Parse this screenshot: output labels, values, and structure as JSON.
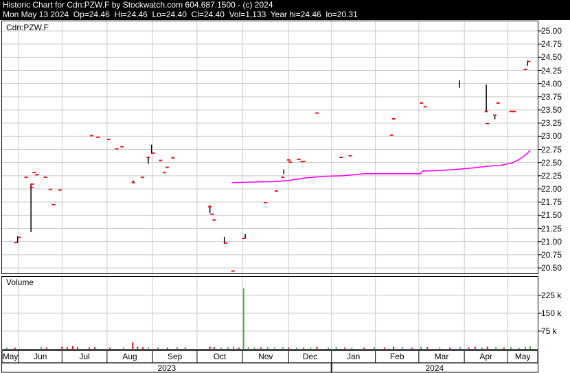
{
  "header": {
    "line1": "Historic Chart for Cdn:PZW.F by Stockwatch.com 604.687.1500 - (c) 2024",
    "line2": "Mon May 13 2024  Op=24.46  Hi=24.46  Lo=24.40  Cl=24.40  Vol=1,133  Year hi=24.46  lo=20.31"
  },
  "price_pane": {
    "symbol_label": "Cdn:PZW.F"
  },
  "volume_pane": {
    "label": "Volume"
  },
  "axes": {
    "price_ticks": [
      "25.00",
      "24.75",
      "24.50",
      "24.25",
      "24.00",
      "23.75",
      "23.50",
      "23.25",
      "23.00",
      "22.75",
      "22.50",
      "22.25",
      "22.00",
      "21.75",
      "21.50",
      "21.25",
      "21.00",
      "20.75",
      "20.50"
    ],
    "volume_ticks": [
      "225 k",
      "150 k",
      "75 k"
    ]
  },
  "colors": {
    "header_bg": "#000000",
    "header_text": "#ffffff",
    "grid": "#c9c9c9",
    "border": "#000000",
    "close_tick_red": "#e61419",
    "ma_magenta": "#ff00ff",
    "volume_up_green": "#4caf50",
    "volume_down_red": "#e61419"
  },
  "chart_data": {
    "type": "line",
    "subtype": "daily-close-tick-chart-with-volume",
    "title": "Historic Chart for Cdn:PZW.F",
    "price_axis": {
      "min": 20.5,
      "max": 25.0,
      "step": 0.25,
      "side": "right"
    },
    "volume_axis": {
      "ticks_k": [
        225,
        150,
        75
      ],
      "unit": "k",
      "side": "right"
    },
    "x_axis": {
      "months": [
        "May",
        "Jun",
        "Jul",
        "Aug",
        "Sep",
        "Oct",
        "Nov",
        "Dec",
        "Jan",
        "Feb",
        "Mar",
        "Apr",
        "May"
      ],
      "month_boundaries_frac": [
        0,
        0.031,
        0.112,
        0.196,
        0.281,
        0.364,
        0.449,
        0.535,
        0.615,
        0.697,
        0.778,
        0.863,
        0.944,
        1
      ],
      "years": [
        {
          "label": "2023",
          "span": [
            0,
            0.615
          ]
        },
        {
          "label": "2024",
          "span": [
            0.615,
            1
          ]
        }
      ]
    },
    "legend": null,
    "grid": true,
    "close_ticks": [
      [
        0.026,
        20.98
      ],
      [
        0.032,
        21.08
      ],
      [
        0.045,
        22.22
      ],
      [
        0.055,
        22.03
      ],
      [
        0.056,
        22.09
      ],
      [
        0.06,
        22.31
      ],
      [
        0.065,
        22.27
      ],
      [
        0.081,
        22.22
      ],
      [
        0.09,
        21.99
      ],
      [
        0.096,
        21.7
      ],
      [
        0.108,
        21.98
      ],
      [
        0.167,
        23.01
      ],
      [
        0.179,
        22.98
      ],
      [
        0.199,
        22.94
      ],
      [
        0.214,
        22.76
      ],
      [
        0.224,
        22.8
      ],
      [
        0.245,
        22.12
      ],
      [
        0.262,
        22.22
      ],
      [
        0.273,
        22.6
      ],
      [
        0.282,
        22.68
      ],
      [
        0.296,
        22.54
      ],
      [
        0.303,
        22.31
      ],
      [
        0.308,
        22.41
      ],
      [
        0.319,
        22.59
      ],
      [
        0.388,
        21.66
      ],
      [
        0.392,
        21.52
      ],
      [
        0.396,
        21.41
      ],
      [
        0.417,
        20.97
      ],
      [
        0.431,
        20.44
      ],
      [
        0.451,
        21.06
      ],
      [
        0.492,
        21.74
      ],
      [
        0.512,
        21.96
      ],
      [
        0.524,
        22.22
      ],
      [
        0.535,
        22.55
      ],
      [
        0.538,
        22.51
      ],
      [
        0.554,
        22.56
      ],
      [
        0.56,
        22.52
      ],
      [
        0.563,
        22.52
      ],
      [
        0.588,
        23.44
      ],
      [
        0.633,
        22.6
      ],
      [
        0.65,
        22.63
      ],
      [
        0.727,
        23.02
      ],
      [
        0.731,
        23.33
      ],
      [
        0.783,
        23.63
      ],
      [
        0.79,
        23.56
      ],
      [
        0.904,
        23.47
      ],
      [
        0.906,
        23.24
      ],
      [
        0.92,
        23.4
      ],
      [
        0.926,
        23.63
      ],
      [
        0.95,
        23.47
      ],
      [
        0.956,
        23.47
      ],
      [
        0.977,
        24.27
      ],
      [
        0.983,
        24.42
      ]
    ],
    "high_low_lines": [
      [
        0.029,
        21.1,
        20.98
      ],
      [
        0.054,
        22.09,
        21.18
      ],
      [
        0.245,
        22.16,
        22.11
      ],
      [
        0.273,
        22.6,
        22.48
      ],
      [
        0.279,
        22.84,
        22.67
      ],
      [
        0.388,
        21.69,
        21.54
      ],
      [
        0.415,
        21.09,
        20.98
      ],
      [
        0.454,
        21.14,
        21.06
      ],
      [
        0.526,
        22.37,
        22.28
      ],
      [
        0.854,
        24.06,
        23.92
      ],
      [
        0.904,
        23.98,
        23.47
      ],
      [
        0.92,
        23.4,
        23.32
      ],
      [
        0.981,
        24.44,
        24.34
      ]
    ],
    "ma_line": [
      [
        0.429,
        22.12
      ],
      [
        0.471,
        22.13
      ],
      [
        0.509,
        22.14
      ],
      [
        0.535,
        22.16
      ],
      [
        0.567,
        22.21
      ],
      [
        0.605,
        22.24
      ],
      [
        0.637,
        22.25
      ],
      [
        0.676,
        22.29
      ],
      [
        0.714,
        22.29
      ],
      [
        0.753,
        22.29
      ],
      [
        0.781,
        22.29
      ],
      [
        0.785,
        22.34
      ],
      [
        0.817,
        22.35
      ],
      [
        0.849,
        22.37
      ],
      [
        0.881,
        22.4
      ],
      [
        0.906,
        22.43
      ],
      [
        0.932,
        22.45
      ],
      [
        0.951,
        22.49
      ],
      [
        0.964,
        22.55
      ],
      [
        0.974,
        22.62
      ],
      [
        0.981,
        22.68
      ],
      [
        0.986,
        22.74
      ]
    ],
    "volume_bars_k": [
      [
        0.009,
        3,
        "u"
      ],
      [
        0.024,
        5,
        "d"
      ],
      [
        0.073,
        8,
        "u"
      ],
      [
        0.083,
        6,
        "d"
      ],
      [
        0.112,
        10,
        "d"
      ],
      [
        0.122,
        8,
        "d"
      ],
      [
        0.132,
        12,
        "d"
      ],
      [
        0.141,
        8,
        "d"
      ],
      [
        0.163,
        6,
        "d"
      ],
      [
        0.173,
        8,
        "d"
      ],
      [
        0.201,
        5,
        "d"
      ],
      [
        0.227,
        4,
        "u"
      ],
      [
        0.244,
        28,
        "d"
      ],
      [
        0.253,
        10,
        "d"
      ],
      [
        0.263,
        8,
        "d"
      ],
      [
        0.273,
        6,
        "u"
      ],
      [
        0.291,
        5,
        "u"
      ],
      [
        0.309,
        6,
        "d"
      ],
      [
        0.327,
        8,
        "u"
      ],
      [
        0.342,
        4,
        "d"
      ],
      [
        0.388,
        10,
        "d"
      ],
      [
        0.396,
        8,
        "d"
      ],
      [
        0.409,
        6,
        "u"
      ],
      [
        0.422,
        8,
        "u"
      ],
      [
        0.432,
        10,
        "u"
      ],
      [
        0.442,
        6,
        "d"
      ],
      [
        0.451,
        255,
        "u"
      ],
      [
        0.46,
        8,
        "u"
      ],
      [
        0.471,
        5,
        "u"
      ],
      [
        0.483,
        6,
        "d"
      ],
      [
        0.496,
        8,
        "u"
      ],
      [
        0.509,
        5,
        "u"
      ],
      [
        0.524,
        8,
        "u"
      ],
      [
        0.535,
        6,
        "d"
      ],
      [
        0.55,
        5,
        "u"
      ],
      [
        0.563,
        6,
        "d"
      ],
      [
        0.576,
        5,
        "u"
      ],
      [
        0.588,
        10,
        "d"
      ],
      [
        0.609,
        5,
        "u"
      ],
      [
        0.624,
        8,
        "u"
      ],
      [
        0.64,
        5,
        "d"
      ],
      [
        0.653,
        6,
        "u"
      ],
      [
        0.676,
        6,
        "d"
      ],
      [
        0.695,
        8,
        "u"
      ],
      [
        0.714,
        5,
        "d"
      ],
      [
        0.731,
        10,
        "d"
      ],
      [
        0.747,
        8,
        "u"
      ],
      [
        0.765,
        6,
        "d"
      ],
      [
        0.782,
        10,
        "u"
      ],
      [
        0.794,
        8,
        "d"
      ],
      [
        0.817,
        6,
        "u"
      ],
      [
        0.836,
        5,
        "d"
      ],
      [
        0.855,
        8,
        "u"
      ],
      [
        0.871,
        5,
        "d"
      ],
      [
        0.883,
        10,
        "d"
      ],
      [
        0.896,
        6,
        "u"
      ],
      [
        0.906,
        10,
        "d"
      ],
      [
        0.922,
        8,
        "u"
      ],
      [
        0.937,
        6,
        "d"
      ],
      [
        0.95,
        8,
        "u"
      ],
      [
        0.965,
        5,
        "u"
      ],
      [
        0.977,
        10,
        "u"
      ],
      [
        0.986,
        12,
        "u"
      ]
    ]
  }
}
